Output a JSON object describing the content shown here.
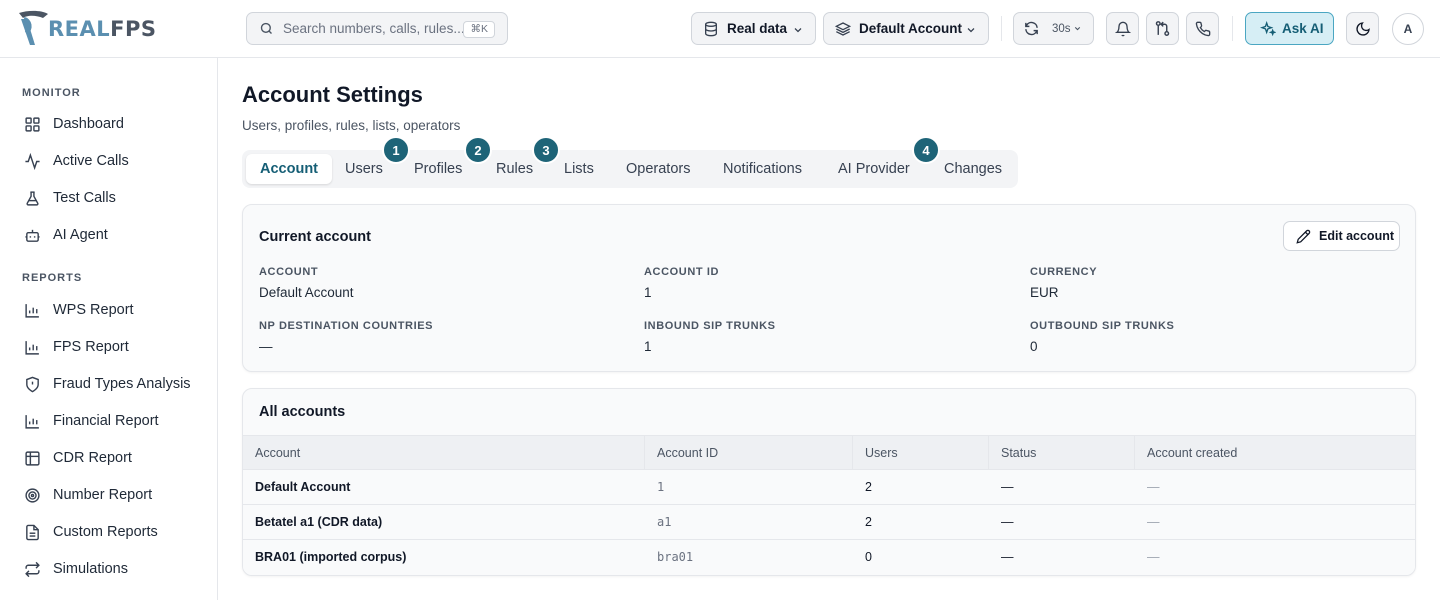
{
  "brand": {
    "part1": "REAL",
    "part2": "FPS"
  },
  "search": {
    "placeholder": "Search numbers, calls, rules...",
    "shortcut": "⌘K"
  },
  "topbar": {
    "data_source": "Real data",
    "account": "Default Account",
    "refresh_interval": "30s",
    "ask_ai": "Ask AI",
    "avatar_initial": "A"
  },
  "sidebar": {
    "monitor_label": "MONITOR",
    "monitor_items": [
      {
        "label": "Dashboard",
        "icon": "grid-icon"
      },
      {
        "label": "Active Calls",
        "icon": "activity-icon"
      },
      {
        "label": "Test Calls",
        "icon": "flask-icon"
      },
      {
        "label": "AI Agent",
        "icon": "bot-icon"
      }
    ],
    "reports_label": "REPORTS",
    "reports_items": [
      {
        "label": "WPS Report",
        "icon": "bar-chart-icon"
      },
      {
        "label": "FPS Report",
        "icon": "bar-chart-icon"
      },
      {
        "label": "Fraud Types Analysis",
        "icon": "shield-alert-icon"
      },
      {
        "label": "Financial Report",
        "icon": "bar-chart-icon"
      },
      {
        "label": "CDR Report",
        "icon": "table-icon"
      },
      {
        "label": "Number Report",
        "icon": "target-icon"
      },
      {
        "label": "Custom Reports",
        "icon": "file-text-icon"
      },
      {
        "label": "Simulations",
        "icon": "repeat-icon"
      }
    ]
  },
  "page": {
    "title": "Account Settings",
    "subtitle": "Users, profiles, rules, lists, operators"
  },
  "tabs": [
    {
      "label": "Account"
    },
    {
      "label": "Users"
    },
    {
      "label": "Profiles"
    },
    {
      "label": "Rules"
    },
    {
      "label": "Lists"
    },
    {
      "label": "Operators"
    },
    {
      "label": "Notifications"
    },
    {
      "label": "AI Provider"
    },
    {
      "label": "Changes"
    }
  ],
  "badges": [
    "1",
    "2",
    "3",
    "4"
  ],
  "current_account": {
    "title": "Current account",
    "edit_label": "Edit account",
    "fields": [
      {
        "label": "ACCOUNT",
        "value": "Default Account"
      },
      {
        "label": "ACCOUNT ID",
        "value": "1"
      },
      {
        "label": "CURRENCY",
        "value": "EUR"
      },
      {
        "label": "NP DESTINATION COUNTRIES",
        "value": "—"
      },
      {
        "label": "INBOUND SIP TRUNKS",
        "value": "1"
      },
      {
        "label": "OUTBOUND SIP TRUNKS",
        "value": "0"
      }
    ]
  },
  "all_accounts": {
    "title": "All accounts",
    "columns": [
      "Account",
      "Account ID",
      "Users",
      "Status",
      "Account created"
    ],
    "rows": [
      {
        "account": "Default Account",
        "id": "1",
        "users": "2",
        "status": "—",
        "created": "—"
      },
      {
        "account": "Betatel a1 (CDR data)",
        "id": "a1",
        "users": "2",
        "status": "—",
        "created": "—"
      },
      {
        "account": "BRA01 (imported corpus)",
        "id": "bra01",
        "users": "0",
        "status": "—",
        "created": "—"
      }
    ]
  },
  "colors": {
    "accent": "#155e75",
    "badge": "#1e6478",
    "ask_ai_bg": "#d6eef5"
  }
}
